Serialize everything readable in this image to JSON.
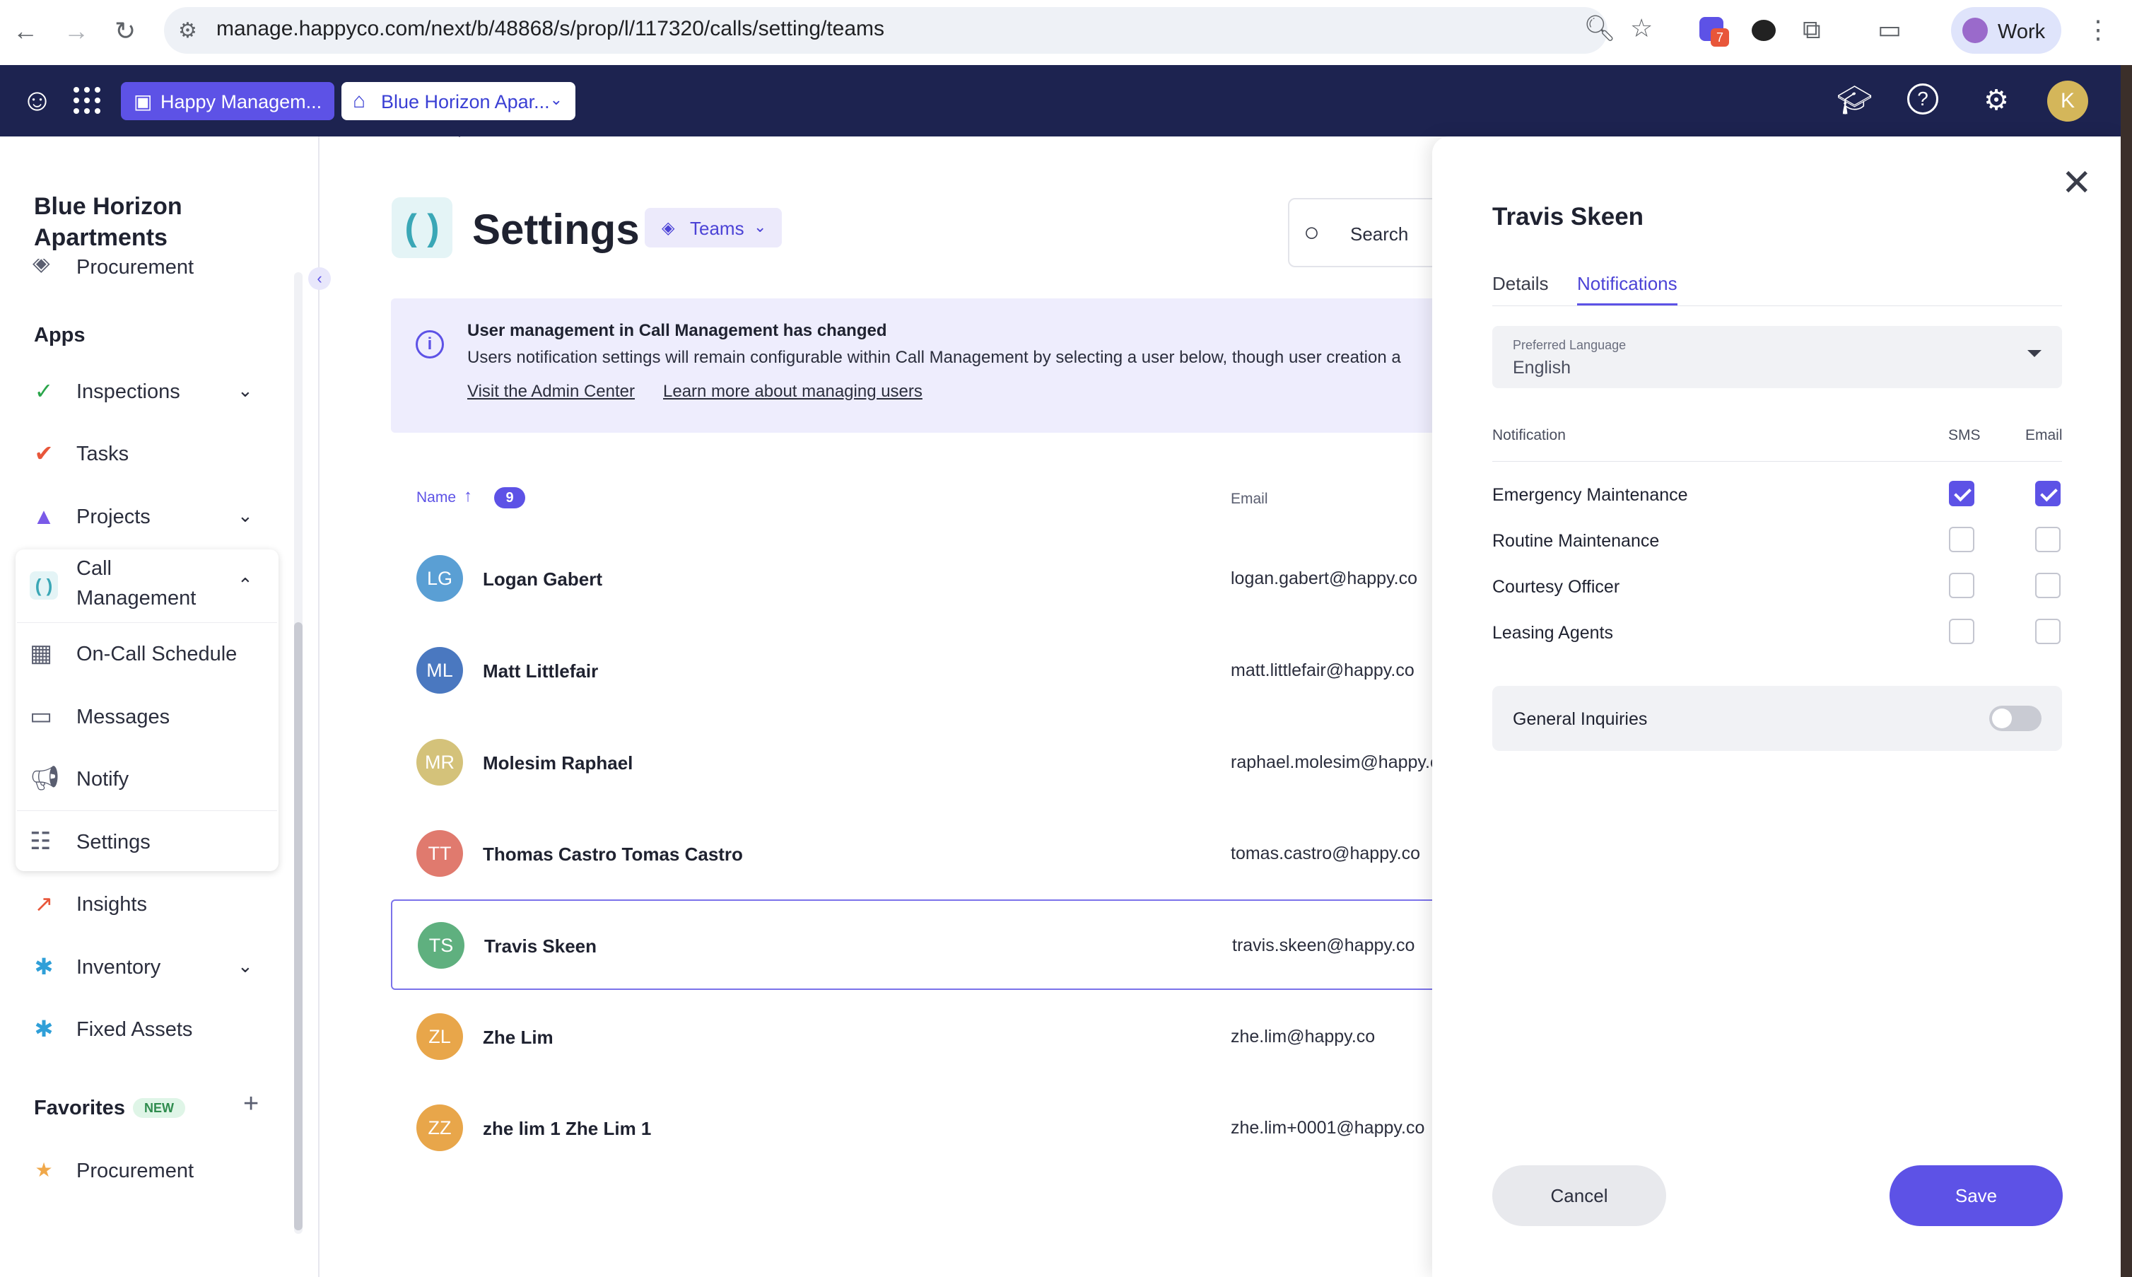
{
  "browser": {
    "url": "manage.happyco.com/next/b/48868/s/prop/l/117320/calls/setting/teams",
    "profile_label": "Work",
    "extension_badge": "7"
  },
  "header": {
    "company_button": "Happy Managem...",
    "property_button": "Blue Horizon Apar...",
    "user_initial": "K"
  },
  "sidebar": {
    "property_title": "Blue Horizon Apartments",
    "partial_item": "Procurement",
    "apps_heading": "Apps",
    "items": [
      {
        "label": "Inspections",
        "color": "#2aa54a"
      },
      {
        "label": "Tasks",
        "color": "#e8563a"
      },
      {
        "label": "Projects",
        "color": "#7a5ae8"
      }
    ],
    "call_management": {
      "label_line1": "Call",
      "label_line2": "Management",
      "subitems": [
        {
          "label": "On-Call Schedule"
        },
        {
          "label": "Messages"
        },
        {
          "label": "Notify"
        },
        {
          "label": "Settings"
        }
      ]
    },
    "items_after": [
      {
        "label": "Insights"
      },
      {
        "label": "Inventory"
      },
      {
        "label": "Fixed Assets"
      }
    ],
    "favorites_heading": "Favorites",
    "favorites_badge": "NEW",
    "favorites": [
      {
        "label": "Procurement"
      }
    ]
  },
  "main": {
    "title": "Settings",
    "teams_dropdown": "Teams",
    "search_placeholder": "Search",
    "banner": {
      "title": "User management in Call Management has changed",
      "body": "Users notification settings will remain configurable within Call Management by selecting a user below, though user creation a",
      "link_admin": "Visit the Admin Center",
      "link_learn": "Learn more about managing users"
    },
    "table": {
      "col_name": "Name",
      "count": "9",
      "col_email": "Email",
      "rows": [
        {
          "initials": "LG",
          "name": "Logan Gabert",
          "email": "logan.gabert@happy.co",
          "color": "#5a9fd4"
        },
        {
          "initials": "ML",
          "name": "Matt Littlefair",
          "email": "matt.littlefair@happy.co",
          "color": "#4a78c0"
        },
        {
          "initials": "MR",
          "name": "Molesim Raphael",
          "email": "raphael.molesim@happy.co",
          "color": "#d4c27a"
        },
        {
          "initials": "TT",
          "name": "Thomas Castro Tomas Castro",
          "email": "tomas.castro@happy.co",
          "color": "#e07a6e"
        },
        {
          "initials": "TS",
          "name": "Travis Skeen",
          "email": "travis.skeen@happy.co",
          "color": "#5fb07f"
        },
        {
          "initials": "ZL",
          "name": "Zhe Lim",
          "email": "zhe.lim@happy.co",
          "color": "#e8a64a"
        },
        {
          "initials": "ZZ",
          "name": "zhe lim 1 Zhe Lim 1",
          "email": "zhe.lim+0001@happy.co",
          "color": "#e8a64a"
        }
      ]
    }
  },
  "drawer": {
    "user_name": "Travis Skeen",
    "tab_details": "Details",
    "tab_notifications": "Notifications",
    "language_label": "Preferred Language",
    "language_value": "English",
    "col_notification": "Notification",
    "col_sms": "SMS",
    "col_email": "Email",
    "notifications": [
      {
        "label": "Emergency Maintenance",
        "sms": true,
        "email": true
      },
      {
        "label": "Routine Maintenance",
        "sms": false,
        "email": false
      },
      {
        "label": "Courtesy Officer",
        "sms": false,
        "email": false
      },
      {
        "label": "Leasing Agents",
        "sms": false,
        "email": false
      }
    ],
    "general_inquiries_label": "General Inquiries",
    "general_inquiries_enabled": false,
    "cancel_label": "Cancel",
    "save_label": "Save"
  },
  "colors": {
    "accent": "#5d52e6",
    "header_bg": "#1d2350"
  }
}
